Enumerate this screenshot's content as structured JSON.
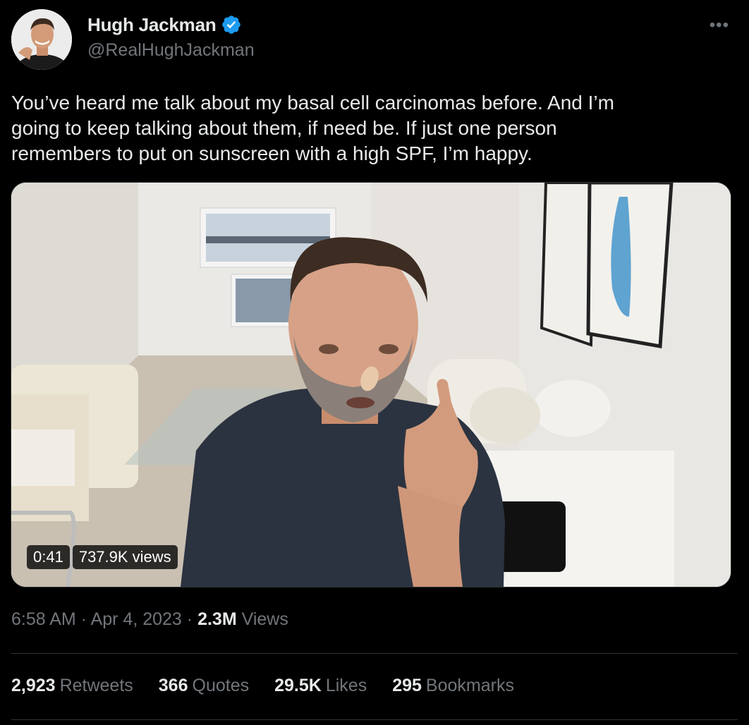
{
  "author": {
    "display_name": "Hugh Jackman",
    "handle": "@RealHughJackman",
    "verified_icon": "verified-badge-icon",
    "verified_color": "#1d9bf0"
  },
  "more_icon": "more-dots-icon",
  "more_glyph": "•••",
  "tweet": {
    "text": "You’ve heard me talk about my basal cell carcinomas before. And I’m\ngoing to keep talking about them, if need be. If just one person\nremembers to put on sunscreen with a high SPF, I’m happy."
  },
  "video": {
    "duration": "0:41",
    "views": "737.9K views"
  },
  "meta": {
    "time": "6:58 AM",
    "sep1": " · ",
    "date": "Apr 4, 2023",
    "sep2": " · ",
    "views_count": "2.3M",
    "views_label": " Views"
  },
  "stats": [
    {
      "count": "2,923",
      "label": "Retweets"
    },
    {
      "count": "366",
      "label": "Quotes"
    },
    {
      "count": "29.5K",
      "label": "Likes"
    },
    {
      "count": "295",
      "label": "Bookmarks"
    }
  ],
  "colors": {
    "background": "#000000",
    "text_primary": "#e7e9ea",
    "text_secondary": "#71767b",
    "divider": "#2f3336"
  }
}
